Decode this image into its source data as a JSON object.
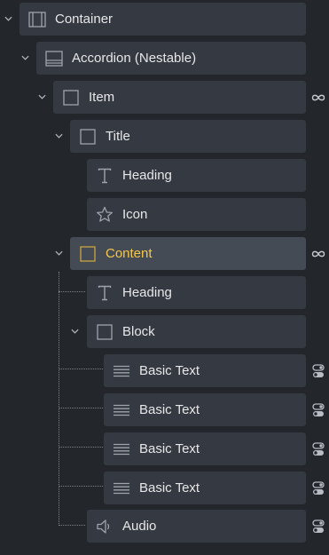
{
  "tree": [
    {
      "label": "Container",
      "icon": "container-icon"
    },
    {
      "label": "Accordion (Nestable)",
      "icon": "accordion-icon"
    },
    {
      "label": "Item",
      "icon": "square-icon",
      "right_icon": "infinity-icon"
    },
    {
      "label": "Title",
      "icon": "square-icon"
    },
    {
      "label": "Heading",
      "icon": "text-t-icon"
    },
    {
      "label": "Icon",
      "icon": "star-icon"
    },
    {
      "label": "Content",
      "icon": "square-icon",
      "right_icon": "infinity-icon",
      "selected": true
    },
    {
      "label": "Heading",
      "icon": "text-t-icon"
    },
    {
      "label": "Block",
      "icon": "square-icon"
    },
    {
      "label": "Basic Text",
      "icon": "lines-icon",
      "right_icon": "toggle-icon"
    },
    {
      "label": "Basic Text",
      "icon": "lines-icon",
      "right_icon": "toggle-icon"
    },
    {
      "label": "Basic Text",
      "icon": "lines-icon",
      "right_icon": "toggle-icon"
    },
    {
      "label": "Basic Text",
      "icon": "lines-icon",
      "right_icon": "toggle-icon"
    },
    {
      "label": "Audio",
      "icon": "speaker-icon",
      "right_icon": "toggle-icon"
    }
  ],
  "colors": {
    "background": "#23262b",
    "card": "#353941",
    "selected_card": "#454b54",
    "selected_text": "#f4c74b",
    "text": "#e6e7e9",
    "icon": "#9ea3ab"
  }
}
